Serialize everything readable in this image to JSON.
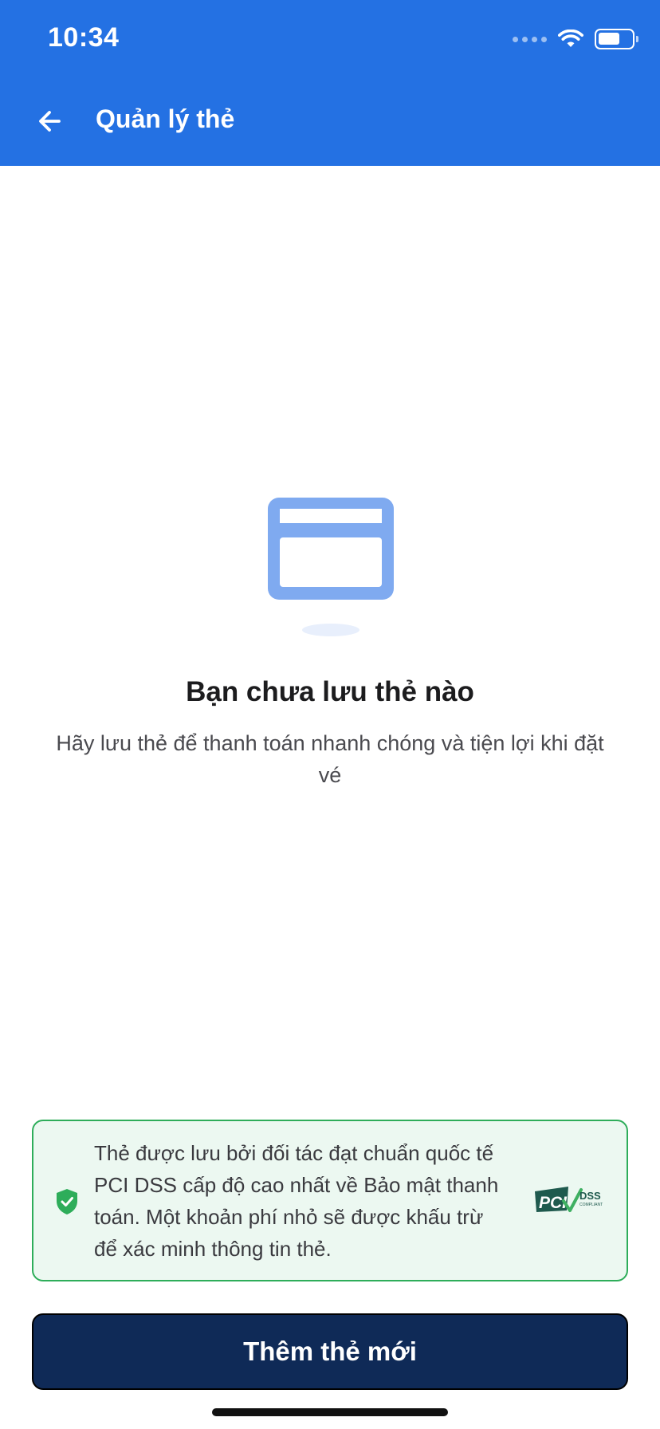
{
  "status_bar": {
    "time": "10:34",
    "icons": [
      "signal-dots-icon",
      "wifi-icon",
      "battery-icon"
    ]
  },
  "header": {
    "title": "Quản lý thẻ",
    "back_icon": "arrow-left-icon",
    "background_color": "#2471e3"
  },
  "empty_state": {
    "illustration_icon": "credit-card-icon",
    "title": "Bạn chưa lưu thẻ nào",
    "subtitle": "Hãy lưu thẻ để thanh toán nhanh chóng và tiện lợi khi đặt vé"
  },
  "security_notice": {
    "icon": "shield-check-icon",
    "text": "Thẻ được lưu bởi đối tác đạt chuẩn quốc tế PCI DSS cấp độ cao nhất về Bảo mật thanh toán. Một khoản phí nhỏ sẽ được khấu trừ để xác minh thông tin thẻ.",
    "badge": {
      "text_main": "PCI",
      "text_dss": "DSS",
      "text_compliant": "COMPLIANT"
    },
    "border_color": "#2ead5a",
    "background_color": "#ecf8f1"
  },
  "primary_action": {
    "label": "Thêm thẻ mới",
    "background_color": "#0f2a57"
  }
}
